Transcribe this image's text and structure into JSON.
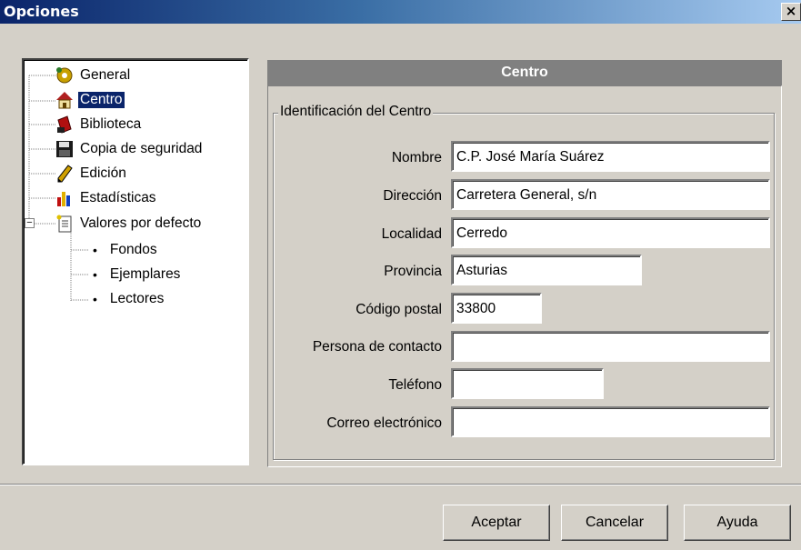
{
  "window": {
    "title": "Opciones",
    "close_glyph": "×"
  },
  "tree": {
    "items": [
      {
        "label": "General",
        "icon": "gears-icon"
      },
      {
        "label": "Centro",
        "icon": "house-icon",
        "selected": true
      },
      {
        "label": "Biblioteca",
        "icon": "books-icon"
      },
      {
        "label": "Copia de seguridad",
        "icon": "floppy-disk-icon"
      },
      {
        "label": "Edición",
        "icon": "pen-icon"
      },
      {
        "label": "Estadísticas",
        "icon": "bar-chart-icon"
      },
      {
        "label": "Valores por defecto",
        "icon": "document-icon",
        "expander": "−"
      }
    ],
    "children": [
      {
        "label": "Fondos",
        "bullet": "•"
      },
      {
        "label": "Ejemplares",
        "bullet": "•"
      },
      {
        "label": "Lectores",
        "bullet": "•"
      }
    ]
  },
  "panel": {
    "header": "Centro",
    "group_title": "Identificación del Centro",
    "fields": {
      "nombre": {
        "label": "Nombre",
        "value": "C.P. José María Suárez"
      },
      "direccion": {
        "label": "Dirección",
        "value": "Carretera General, s/n"
      },
      "localidad": {
        "label": "Localidad",
        "value": "Cerredo"
      },
      "provincia": {
        "label": "Provincia",
        "value": "Asturias"
      },
      "codigo_postal": {
        "label": "Código postal",
        "value": "33800"
      },
      "persona_contacto": {
        "label": "Persona de contacto",
        "value": ""
      },
      "telefono": {
        "label": "Teléfono",
        "value": ""
      },
      "correo": {
        "label": "Correo electrónico",
        "value": ""
      }
    }
  },
  "buttons": {
    "ok": "Aceptar",
    "cancel": "Cancelar",
    "help": "Ayuda"
  },
  "colors": {
    "selection": "#0a246a",
    "header_bg": "#808080",
    "face": "#d4d0c8"
  }
}
